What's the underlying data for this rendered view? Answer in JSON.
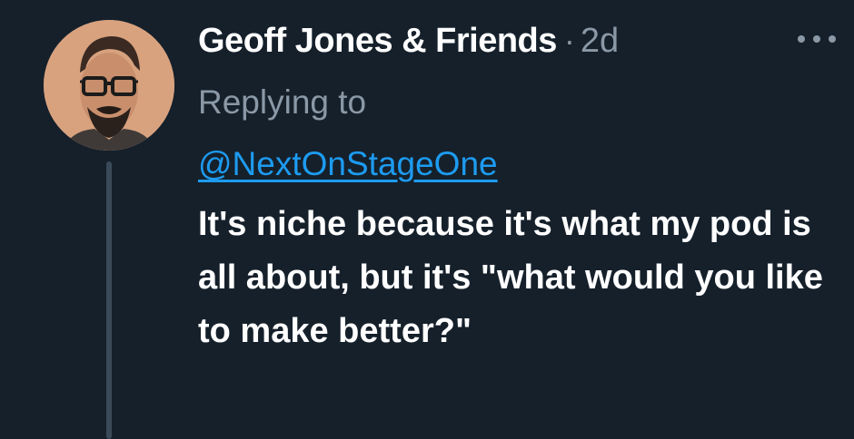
{
  "tweet": {
    "author_name": "Geoff Jones & Friends",
    "separator": "·",
    "time": "2d",
    "more_icon": "more-horizontal-icon",
    "replying_to_label": "Replying to",
    "replying_to_handle": "@NextOnStageOne",
    "body": "It's niche because it's what my pod is all about, but it's \"what would you like to make better?\""
  },
  "colors": {
    "background": "#15202b",
    "primary_text": "#ffffff",
    "secondary_text": "#8b98a5",
    "link": "#1d9bf0",
    "thread_line": "#3b4a59"
  }
}
